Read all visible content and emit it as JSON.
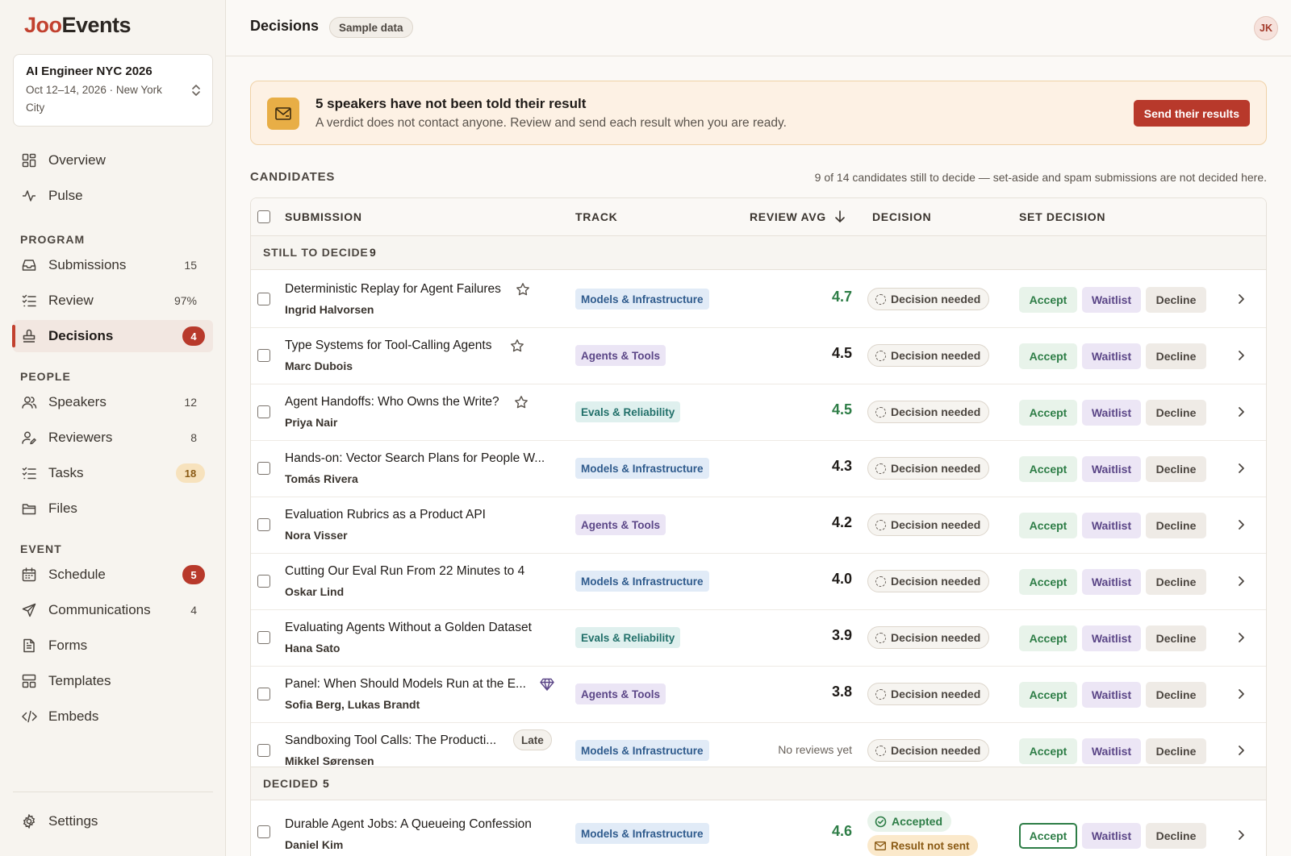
{
  "app": {
    "logo_part1": "Joo",
    "logo_part2": "Events"
  },
  "event": {
    "name": "AI Engineer NYC 2026",
    "details": "Oct 12–14, 2026 · New York City"
  },
  "nav": {
    "overview": "Overview",
    "pulse": "Pulse",
    "program_section": "PROGRAM",
    "submissions": {
      "label": "Submissions",
      "count": "15"
    },
    "review": {
      "label": "Review",
      "count": "97%"
    },
    "decisions": {
      "label": "Decisions",
      "count": "4"
    },
    "people_section": "PEOPLE",
    "speakers": {
      "label": "Speakers",
      "count": "12"
    },
    "reviewers": {
      "label": "Reviewers",
      "count": "8"
    },
    "tasks": {
      "label": "Tasks",
      "count": "18"
    },
    "files": "Files",
    "event_section": "EVENT",
    "schedule": {
      "label": "Schedule",
      "count": "5"
    },
    "communications": {
      "label": "Communications",
      "count": "4"
    },
    "forms": "Forms",
    "templates": "Templates",
    "embeds": "Embeds",
    "settings": "Settings"
  },
  "header": {
    "title": "Decisions",
    "chip": "Sample data",
    "avatar": "JK"
  },
  "alert": {
    "title": "5 speakers have not been told their result",
    "text": "A verdict does not contact anyone. Review and send each result when you are ready.",
    "button": "Send their results"
  },
  "candidates": {
    "title": "CANDIDATES",
    "note": "9 of 14 candidates still to decide — set-aside and spam submissions are not decided here.",
    "columns": {
      "submission": "SUBMISSION",
      "track": "TRACK",
      "review_avg": "REVIEW AVG",
      "decision": "DECISION",
      "set_decision": "SET DECISION"
    },
    "group_pending": {
      "label": "STILL TO DECIDE",
      "count": "9"
    },
    "group_decided": {
      "label": "DECIDED",
      "count": "5"
    },
    "actions": {
      "accept": "Accept",
      "waitlist": "Waitlist",
      "decline": "Decline"
    },
    "status_needed": "Decision needed",
    "rows": [
      {
        "title": "Deterministic Replay for Agent Failures",
        "author": "Ingrid Halvorsen",
        "track": "Models & Infrastructure",
        "score": "4.7"
      },
      {
        "title": "Type Systems for Tool-Calling Agents",
        "author": "Marc Dubois",
        "track": "Agents & Tools",
        "score": "4.5"
      },
      {
        "title": "Agent Handoffs: Who Owns the Write?",
        "author": "Priya Nair",
        "track": "Evals & Reliability",
        "score": "4.5"
      },
      {
        "title": "Hands-on: Vector Search Plans for People W...",
        "author": "Tomás Rivera",
        "track": "Models & Infrastructure",
        "score": "4.3"
      },
      {
        "title": "Evaluation Rubrics as a Product API",
        "author": "Nora Visser",
        "track": "Agents & Tools",
        "score": "4.2"
      },
      {
        "title": "Cutting Our Eval Run From 22 Minutes to 4",
        "author": "Oskar Lind",
        "track": "Models & Infrastructure",
        "score": "4.0"
      },
      {
        "title": "Evaluating Agents Without a Golden Dataset",
        "author": "Hana Sato",
        "track": "Evals & Reliability",
        "score": "3.9"
      },
      {
        "title": "Panel: When Should Models Run at the E...",
        "author": "Sofia Berg, Lukas Brandt",
        "track": "Agents & Tools",
        "score": "3.8"
      },
      {
        "title": "Sandboxing Tool Calls: The Producti...",
        "author": "Mikkel Sørensen",
        "track": "Models & Infrastructure",
        "score": "No reviews yet",
        "tag": "Late"
      }
    ],
    "decided_rows": [
      {
        "title": "Durable Agent Jobs: A Queueing Confession",
        "author": "Daniel Kim",
        "track": "Models & Infrastructure",
        "score": "4.6",
        "status": "Accepted",
        "result": "Result not sent"
      }
    ]
  }
}
